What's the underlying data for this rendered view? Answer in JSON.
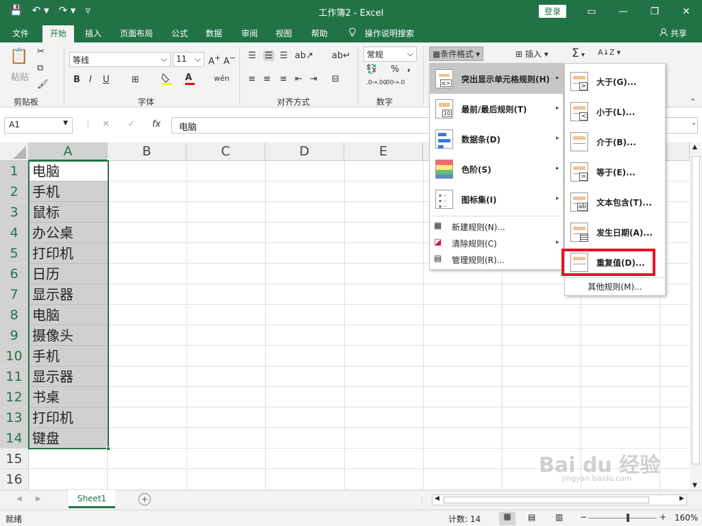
{
  "titlebar": {
    "title": "工作簿2 - Excel",
    "login": "登录",
    "qat": [
      "💾",
      "↶ ▾",
      "↷ ▾",
      "▿"
    ],
    "window_buttons": [
      "▭",
      "—",
      "❐",
      "✕"
    ]
  },
  "tabs": [
    "文件",
    "开始",
    "插入",
    "页面布局",
    "公式",
    "数据",
    "审阅",
    "视图",
    "帮助"
  ],
  "tell_me": "操作说明搜索",
  "share": "共享",
  "ribbon": {
    "paste": "粘贴",
    "font_name": "等线",
    "font_size": "11",
    "number_format": "常规",
    "bold": "B",
    "italic": "I",
    "underline": "U",
    "font_color": "A",
    "increase_font": "A",
    "decrease_font": "A",
    "percent": "%",
    "comma": ",",
    "inc_decimal": ".0→.00",
    "dec_decimal": ".00→.0",
    "cond_format": "条件格式",
    "insert": "插入",
    "sum": "Σ",
    "sort": "A↓Z",
    "groups": [
      "剪贴板",
      "字体",
      "对齐方式",
      "数字"
    ]
  },
  "formula_bar": {
    "name_box": "A1",
    "fx": "fx",
    "cancel": "✕",
    "enter": "✓",
    "content": "电脑"
  },
  "columns": [
    "A",
    "B",
    "C",
    "D",
    "E"
  ],
  "rows": [
    "1",
    "2",
    "3",
    "4",
    "5",
    "6",
    "7",
    "8",
    "9",
    "10",
    "11",
    "12",
    "13",
    "14",
    "15",
    "16"
  ],
  "cells_A": [
    "电脑",
    "手机",
    "鼠标",
    "办公桌",
    "打印机",
    "日历",
    "显示器",
    "电脑",
    "摄像头",
    "手机",
    "显示器",
    "书桌",
    "打印机",
    "键盘"
  ],
  "sheet_tab": "Sheet1",
  "add_sheet": "+",
  "status": {
    "ready": "就绪",
    "count": "计数: 14",
    "zoom": "160%",
    "zoom_minus": "−",
    "zoom_plus": "+"
  },
  "cf_menu": [
    {
      "label": "突出显示单元格规则(H)"
    },
    {
      "label": "最前/最后规则(T)"
    },
    {
      "label": "数据条(D)"
    },
    {
      "label": "色阶(S)"
    },
    {
      "label": "图标集(I)"
    },
    {
      "label": "新建规则(N)..."
    },
    {
      "label": "清除规则(C)"
    },
    {
      "label": "管理规则(R)..."
    }
  ],
  "sub_menu": [
    {
      "label": "大于(G)...",
      "glyph": ">"
    },
    {
      "label": "小于(L)...",
      "glyph": "<"
    },
    {
      "label": "介于(B)...",
      "glyph": ""
    },
    {
      "label": "等于(E)...",
      "glyph": "="
    },
    {
      "label": "文本包含(T)...",
      "glyph": "ab"
    },
    {
      "label": "发生日期(A)...",
      "glyph": ""
    },
    {
      "label": "重复值(D)...",
      "glyph": ""
    },
    {
      "label": "其他规则(M)..."
    }
  ],
  "highlight_box_color": "#e81123",
  "icon_marks": {
    "rule_up": "10",
    "highlight_rule": "≤>"
  },
  "watermark": {
    "brand": "Bai du 经验",
    "url": "jingyan.baidu.com"
  },
  "brand_color": "#217346"
}
